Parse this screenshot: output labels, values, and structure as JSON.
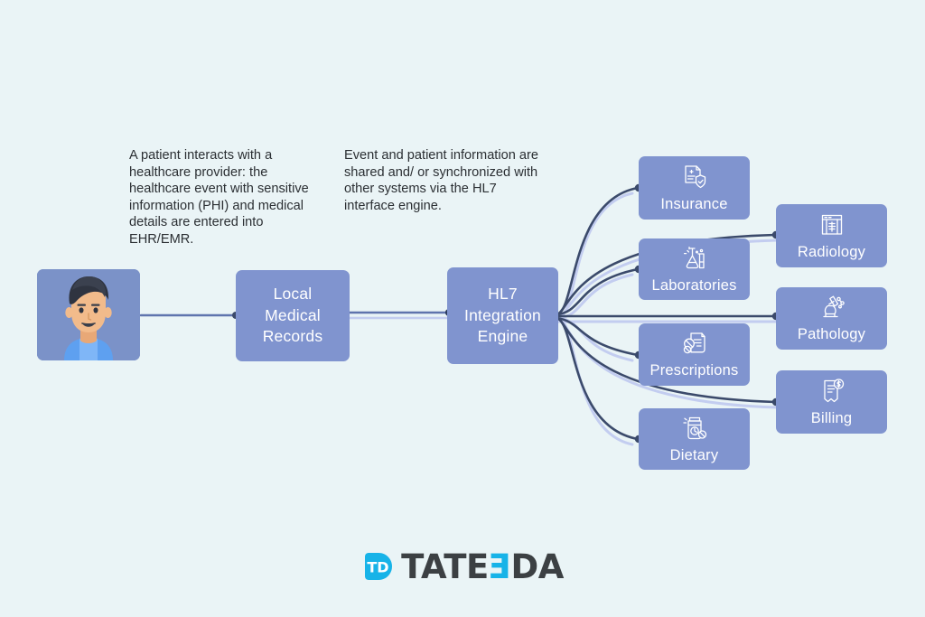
{
  "page": {
    "background_color": "#eaf4f6",
    "title": "HL7 Integration Engine data flow diagram"
  },
  "colors": {
    "background": "#eaf4f6",
    "node_fill": "#8094cf",
    "node_text": "#ffffff",
    "note_text": "#2b2f33",
    "wire_dark": "#3b4a6b",
    "wire_light": "#c3cdf0",
    "logo_accent": "#17b3e8",
    "logo_word": "#3c4043"
  },
  "notes": [
    {
      "id": "note-patient",
      "text": "A patient interacts with a healthcare provider: the healthcare event with sensitive information (PHI) and medical details are entered into EHR/EMR."
    },
    {
      "id": "note-engine",
      "text": "Event and patient information are shared and/ or synchronized with other systems via the HL7 interface engine."
    }
  ],
  "nodes": {
    "patient": {
      "name": "patient-avatar",
      "icon": "patient-avatar-illustration",
      "label": ""
    },
    "local_records": {
      "name": "local-medical-records",
      "label": "Local\nMedical\nRecords"
    },
    "hl7_engine": {
      "name": "hl7-integration-engine",
      "label": "HL7\nIntegration\nEngine"
    }
  },
  "services": {
    "inner_column": [
      {
        "id": "insurance",
        "label": "Insurance",
        "icon": "insurance-document-shield-icon"
      },
      {
        "id": "laboratories",
        "label": "Laboratories",
        "icon": "lab-flasks-icon"
      },
      {
        "id": "prescriptions",
        "label": "Prescriptions",
        "icon": "prescription-pills-icon"
      },
      {
        "id": "dietary",
        "label": "Dietary",
        "icon": "dietary-supplement-jar-icon"
      }
    ],
    "outer_column": [
      {
        "id": "radiology",
        "label": "Radiology",
        "icon": "radiology-xray-scan-icon"
      },
      {
        "id": "pathology",
        "label": "Pathology",
        "icon": "pathology-microscope-icon"
      },
      {
        "id": "billing",
        "label": "Billing",
        "icon": "billing-invoice-dollar-icon"
      }
    ]
  },
  "logo": {
    "mark_text": "TD",
    "word_prefix": "TATE",
    "word_reversed_e": "E",
    "word_suffix": "DA"
  }
}
